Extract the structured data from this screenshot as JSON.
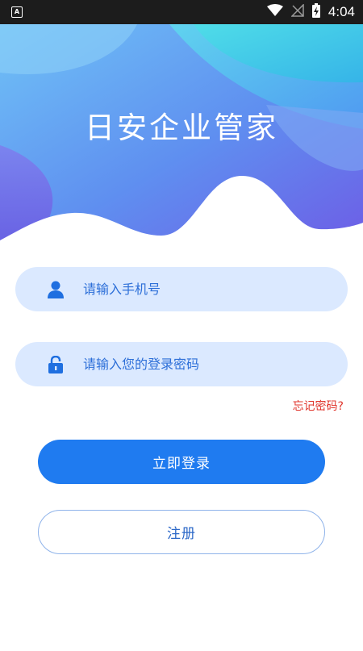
{
  "status_bar": {
    "left_icon": "A",
    "time": "4:04",
    "icons": [
      "wifi-icon",
      "signal-off-icon",
      "battery-charging-icon"
    ]
  },
  "header": {
    "title": "日安企业管家"
  },
  "form": {
    "phone_placeholder": "请输入手机号",
    "password_placeholder": "请输入您的登录密码",
    "forgot_label": "忘记密码?",
    "login_label": "立即登录",
    "register_label": "注册"
  },
  "colors": {
    "accent": "#1f7bf0",
    "field_bg": "#dbe9ff",
    "forgot": "#e0342b"
  }
}
